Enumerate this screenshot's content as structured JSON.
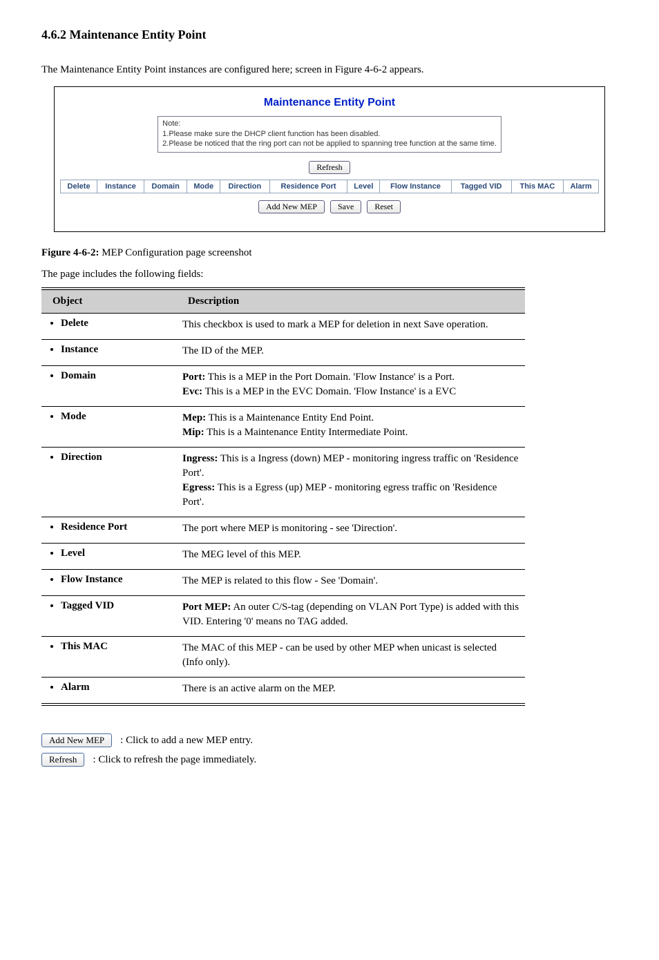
{
  "section_heading": "4.6.2 Maintenance Entity Point",
  "intro": "The Maintenance Entity Point instances are configured here; screen in Figure 4-6-2 appears.",
  "screenshot": {
    "title": "Maintenance Entity Point",
    "note_head": "Note:",
    "note1": "1.Please make sure the DHCP client function has been disabled.",
    "note2": "2.Please be noticed that the ring port can not be applied to spanning tree function at the same time.",
    "refresh_btn": "Refresh",
    "add_btn": "Add New MEP",
    "save_btn": "Save",
    "reset_btn": "Reset",
    "headers": [
      "Delete",
      "Instance",
      "Domain",
      "Mode",
      "Direction",
      "Residence Port",
      "Level",
      "Flow Instance",
      "Tagged VID",
      "This MAC",
      "Alarm"
    ]
  },
  "caption_prefix": "Figure 4-6-2:",
  "caption_rest": " MEP Configuration page screenshot",
  "ref": {
    "intro": "The page includes the following fields:",
    "head_obj": "Object",
    "head_desc": "Description",
    "rows": [
      {
        "obj": "Delete",
        "desc": "This checkbox is used to mark a MEP for deletion in next Save operation."
      },
      {
        "obj": "Instance",
        "desc": "The ID of the MEP."
      },
      {
        "obj": "Domain",
        "desc": [
          {
            "bold": true,
            "text": "Port:"
          },
          {
            "text": " This is a MEP in the Port Domain. '"
          },
          {
            "bold": false,
            "text": "Flow Instance"
          },
          {
            "text": "' is a Port."
          },
          {
            "br": true
          },
          {
            "bold": true,
            "text": "Evc:"
          },
          {
            "text": " This is a MEP in the EVC Domain. 'Flow Instance' is a EVC"
          }
        ]
      },
      {
        "obj": "Mode",
        "desc": [
          {
            "bold": true,
            "text": "Mep:"
          },
          {
            "text": " This is a Maintenance Entity End Point."
          },
          {
            "br": true
          },
          {
            "bold": true,
            "text": "Mip:"
          },
          {
            "text": " This is a Maintenance Entity Intermediate Point."
          }
        ]
      },
      {
        "obj": "Direction",
        "desc": [
          {
            "bold": true,
            "text": "Ingress:"
          },
          {
            "text": " This is a Ingress (down) MEP - monitoring ingress traffic on 'Residence Port'."
          },
          {
            "br": true
          },
          {
            "bold": true,
            "text": "Egress:"
          },
          {
            "text": " This is a Egress (up) MEP - monitoring egress traffic on 'Residence Port'."
          }
        ]
      },
      {
        "obj": "Residence Port",
        "desc": "The port where MEP is monitoring - see 'Direction'."
      },
      {
        "obj": "Level",
        "desc": "The MEG level of this MEP."
      },
      {
        "obj": "Flow Instance",
        "desc": "The MEP is related to this flow - See 'Domain'."
      },
      {
        "obj": "Tagged VID",
        "desc": [
          {
            "bold": true,
            "text": "Port MEP:"
          },
          {
            "text": " An outer C/S-tag (depending on VLAN Port Type) is added with this VID. Entering '0' means no TAG added."
          }
        ]
      },
      {
        "obj": "This MAC",
        "desc": "The MAC of this MEP - can be used by other MEP when unicast is selected (Info only)."
      },
      {
        "obj": "Alarm",
        "desc": "There is an active alarm on the MEP."
      }
    ]
  },
  "buttons": {
    "add": "Add New MEP",
    "add_desc": ": Click to add a new MEP entry.",
    "refresh": "Refresh",
    "refresh_desc": ": Click to refresh the page immediately."
  }
}
